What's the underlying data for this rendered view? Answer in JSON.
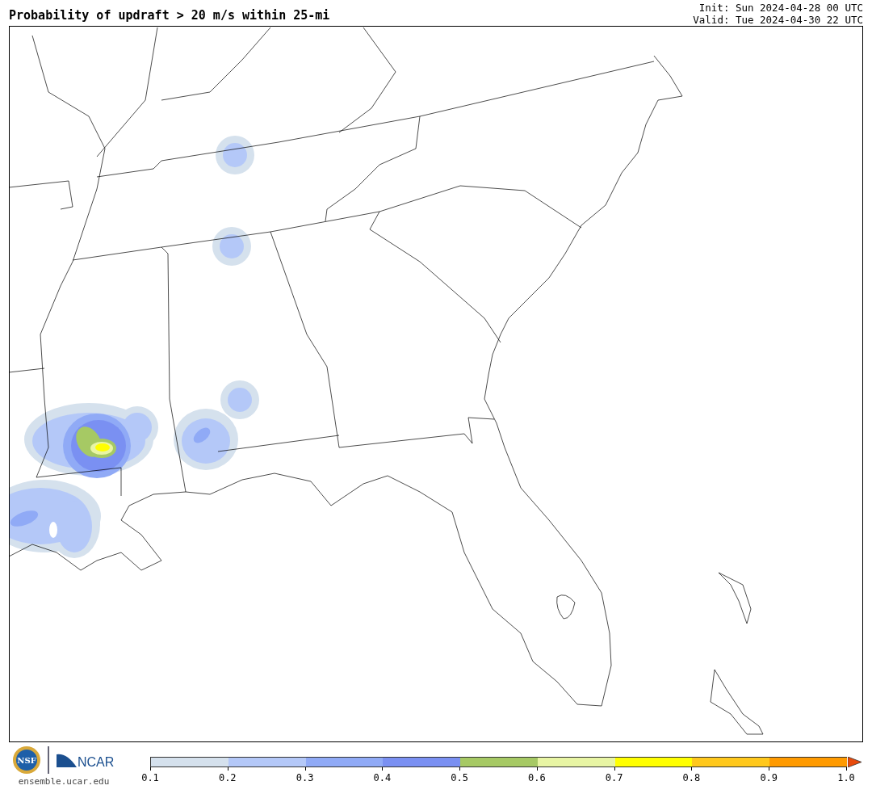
{
  "title": "Probability of updraft > 20 m/s within 25-mi",
  "init": "Init: Sun 2024-04-28 00 UTC",
  "valid": "Valid: Tue 2024-04-30 22 UTC",
  "logos": {
    "nsf": "NSF",
    "ncar": "NCAR",
    "site": "ensemble.ucar.edu"
  },
  "colorbar": {
    "bins": [
      {
        "color": "#d5e1ed"
      },
      {
        "color": "#b4c8f8"
      },
      {
        "color": "#90aaf6"
      },
      {
        "color": "#7a90f2"
      },
      {
        "color": "#a6c964"
      },
      {
        "color": "#e8f5a4"
      },
      {
        "color": "#ffff00"
      },
      {
        "color": "#ffc81c"
      },
      {
        "color": "#ff9a00"
      }
    ],
    "extend": {
      "color": "#e84a0c"
    },
    "ticks": [
      "0.1",
      "0.2",
      "0.3",
      "0.4",
      "0.5",
      "0.6",
      "0.7",
      "0.8",
      "0.9",
      "1.0"
    ]
  }
}
